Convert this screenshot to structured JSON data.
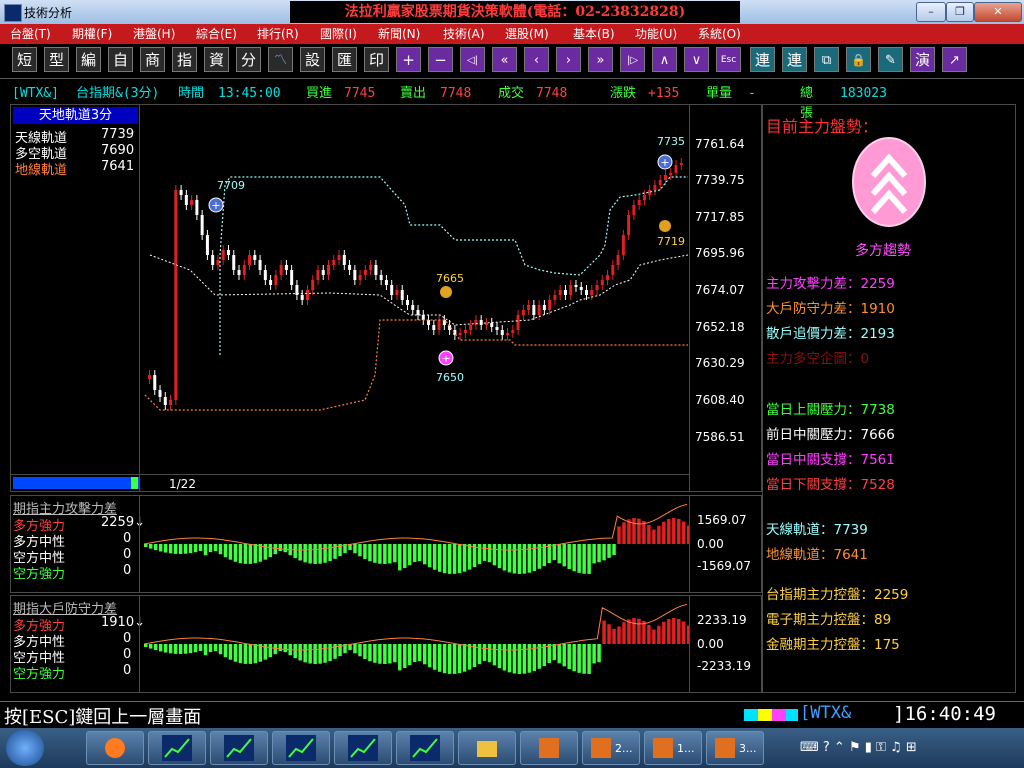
{
  "window": {
    "title": "技術分析",
    "ad_banner": "法拉利贏家股票期貨決策軟體(電話：02-23832828)",
    "minimize": "–",
    "maximize": "❐",
    "close": "✕"
  },
  "menu": [
    "台盤(T)",
    "期權(F)",
    "港盤(H)",
    "綜合(E)",
    "排行(R)",
    "國際(I)",
    "新聞(N)",
    "技術(A)",
    "選股(M)",
    "基本(B)",
    "功能(U)",
    "系統(O)"
  ],
  "toolbar": [
    "短",
    "型",
    "編",
    "自",
    "商",
    "指",
    "資",
    "分",
    "〽",
    "設",
    "匯",
    "印",
    "+",
    "−",
    "◁|",
    "«",
    "‹",
    "›",
    "»",
    "|▷",
    "∧",
    "∨",
    "Esc",
    "連",
    "連",
    "⧉",
    "🔒",
    "✎",
    "演",
    "↗"
  ],
  "quote": {
    "code": "[WTX&]",
    "name": "台指期&(3分)",
    "time_label": "時間",
    "time": "13:45:00",
    "bid_label": "買進",
    "bid": "7745",
    "ask_label": "賣出",
    "ask": "7748",
    "deal_label": "成交",
    "deal": "7748",
    "change_label": "漲跌",
    "change": "+135",
    "vol_label": "單量",
    "vol": "-",
    "total_label": "總張",
    "total": "183023"
  },
  "main_chart": {
    "header": "天地軌道3分",
    "upper_label": "天線軌道",
    "upper": "7739",
    "mid_label": "多空軌道",
    "mid": "7690",
    "lower_label": "地線軌道",
    "lower": "7641",
    "date": "1/22",
    "y_ticks": [
      "7761.64",
      "7739.75",
      "7717.85",
      "7695.96",
      "7674.07",
      "7652.18",
      "7630.29",
      "7608.40",
      "7586.51"
    ],
    "markers": {
      "m1": "7709",
      "m2": "7665",
      "m3": "7650",
      "m4": "7735",
      "m5": "7719"
    }
  },
  "attack_panel": {
    "title": "期指主力攻擊力差",
    "rows": [
      {
        "label": "多方強力",
        "value": "2259↓"
      },
      {
        "label": "多方中性",
        "value": "0"
      },
      {
        "label": "空方中性",
        "value": "0"
      },
      {
        "label": "空方強力",
        "value": "0"
      }
    ],
    "y_ticks": [
      "1569.07",
      "0.00",
      "-1569.07"
    ]
  },
  "defense_panel": {
    "title": "期指大戶防守力差",
    "rows": [
      {
        "label": "多方強力",
        "value": "1910↓"
      },
      {
        "label": "多方中性",
        "value": "0"
      },
      {
        "label": "空方中性",
        "value": "0"
      },
      {
        "label": "空方強力",
        "value": "0"
      }
    ],
    "y_ticks": [
      "2233.19",
      "0.00",
      "-2233.19"
    ]
  },
  "right_panel": {
    "trend_title": "目前主力盤勢：",
    "trend_label": "多方趨勢",
    "l1": "主力攻擊力差：2259",
    "l2": "大戶防守力差：1910",
    "l3": "散戶追價力差：2193",
    "l4": "主力多空企圖：0",
    "l5": "當日上關壓力：7738",
    "l6": "前日中關壓力：7666",
    "l7": "當日中關支撐：7561",
    "l8": "當日下關支撐：7528",
    "l9": "天線軌道：7739",
    "l10": "地線軌道：7641",
    "l11": "台指期主力控盤：2259",
    "l12": "電子期主力控盤：89",
    "l13": "金融期主力控盤：175"
  },
  "status": {
    "hint": "按[ESC]鍵回上一層畫面",
    "code": "[WTX&",
    "clock": "]16:40:49"
  },
  "taskbar": {
    "t1": "2...",
    "t2": "1...",
    "t3": "3..."
  },
  "colors": {
    "menu_red": "#c4191d",
    "up_red": "#e22020",
    "down_white": "#ffffff",
    "upper_band": "#9ff",
    "lower_band": "#ff8040",
    "pink": "#ff40ff",
    "yellow": "#ffd040",
    "green": "#40ff40"
  }
}
